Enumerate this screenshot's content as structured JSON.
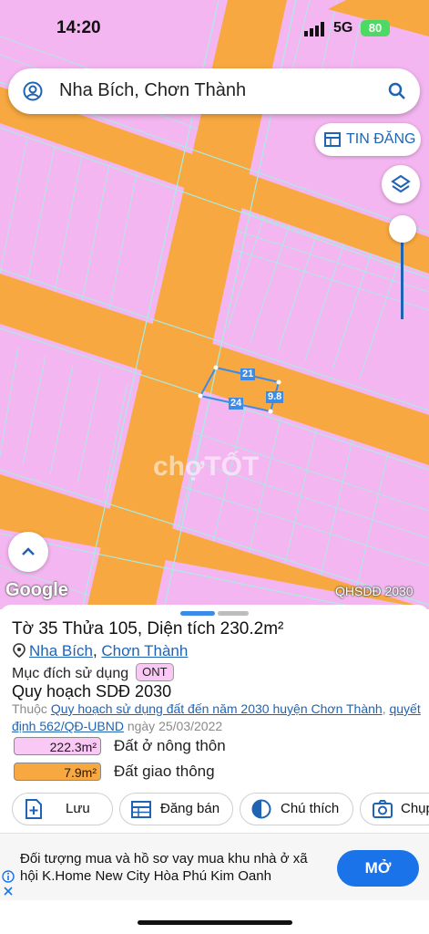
{
  "status_bar": {
    "time": "14:20",
    "network": "5G",
    "battery": "80"
  },
  "search": {
    "text": "Nha Bích, Chơn Thành"
  },
  "tin_dang": {
    "label": "TIN ĐĂNG"
  },
  "map": {
    "plot_labels": [
      "21",
      "9.8",
      "24"
    ],
    "watermark": "chợTỐT",
    "google_label": "Google",
    "layer_label": "QHSDĐ 2030",
    "colors": {
      "residential": "#f4b6f0",
      "road": "#f7a840",
      "plot": "#3c8be6"
    }
  },
  "parcel": {
    "title": "Tờ 35 Thửa 105, Diện tích 230.2m²",
    "location_1": "Nha Bích",
    "location_sep": ", ",
    "location_2": "Chơn Thành",
    "purpose_label": "Mục đích sử dụng",
    "purpose_code": "ONT",
    "plan_title": "Quy hoạch SDĐ 2030",
    "belongs_prefix": "Thuộc ",
    "belongs_link": "Quy hoạch sử dụng đất đến năm 2030 huyện Chơn Thành",
    "belongs_sep": ", ",
    "decision_link": "quyết định 562/QĐ-UBND",
    "decision_date": " ngày 25/03/2022",
    "legend": [
      {
        "value": "222.3m²",
        "label": "Đất ở nông thôn",
        "color": "#f9c8f4"
      },
      {
        "value": "7.9m²",
        "label": "Đất giao thông",
        "color": "#f7a840"
      }
    ]
  },
  "actions": {
    "save": "Lưu",
    "post": "Đăng bán",
    "note": "Chú thích",
    "capture": "Chụp"
  },
  "ad": {
    "text": "Đối tượng mua và hồ sơ vay mua khu nhà ở xã hội K.Home New City Hòa Phú Kim Oanh",
    "button": "MỞ"
  }
}
